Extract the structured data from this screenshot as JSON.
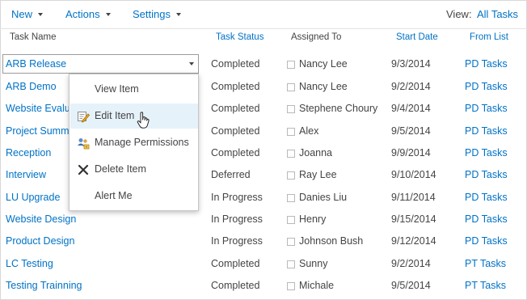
{
  "toolbar": {
    "new_label": "New",
    "actions_label": "Actions",
    "settings_label": "Settings",
    "view_label": "View:",
    "view_value": "All Tasks"
  },
  "columns": {
    "task_name": "Task Name",
    "task_status": "Task Status",
    "assigned_to": "Assigned To",
    "start_date": "Start Date",
    "from_list": "From List"
  },
  "rows": [
    {
      "task": "ARB Release",
      "status": "Completed",
      "assigned": "Nancy Lee",
      "date": "9/3/2014",
      "from": "PD Tasks"
    },
    {
      "task": "ARB Demo",
      "status": "Completed",
      "assigned": "Nancy Lee",
      "date": "9/2/2014",
      "from": "PD Tasks"
    },
    {
      "task": "Website Evalu",
      "status": "Completed",
      "assigned": "Stephene Choury",
      "date": "9/4/2014",
      "from": "PD Tasks"
    },
    {
      "task": "Project Summ",
      "status": "Completed",
      "assigned": "Alex",
      "date": "9/5/2014",
      "from": "PD Tasks"
    },
    {
      "task": "Reception",
      "status": "Completed",
      "assigned": "Joanna",
      "date": "9/9/2014",
      "from": "PD Tasks"
    },
    {
      "task": "Interview",
      "status": "Deferred",
      "assigned": "Ray Lee",
      "date": "9/10/2014",
      "from": "PD Tasks"
    },
    {
      "task": "LU Upgrade",
      "status": "In Progress",
      "assigned": "Danies Liu",
      "date": "9/11/2014",
      "from": "PD Tasks"
    },
    {
      "task": "Website Design",
      "status": "In Progress",
      "assigned": "Henry",
      "date": "9/15/2014",
      "from": "PD Tasks"
    },
    {
      "task": "Product Design",
      "status": "In Progress",
      "assigned": "Johnson Bush",
      "date": "9/12/2014",
      "from": "PD Tasks"
    },
    {
      "task": "LC Testing",
      "status": "Completed",
      "assigned": "Sunny",
      "date": "9/2/2014",
      "from": "PT Tasks"
    },
    {
      "task": "Testing Trainning",
      "status": "Completed",
      "assigned": "Michale",
      "date": "9/5/2014",
      "from": "PT Tasks"
    }
  ],
  "menu": {
    "items": [
      {
        "label": "View Item",
        "icon": "none"
      },
      {
        "label": "Edit Item",
        "icon": "edit-icon"
      },
      {
        "label": "Manage Permissions",
        "icon": "permissions-icon"
      },
      {
        "label": "Delete Item",
        "icon": "delete-x-icon"
      },
      {
        "label": "Alert Me",
        "icon": "none"
      }
    ],
    "hovered": "Edit Item"
  },
  "colors": {
    "link": "#0072c6",
    "text": "#444444",
    "hover": "#e6f2fa",
    "delete": "#333333"
  }
}
